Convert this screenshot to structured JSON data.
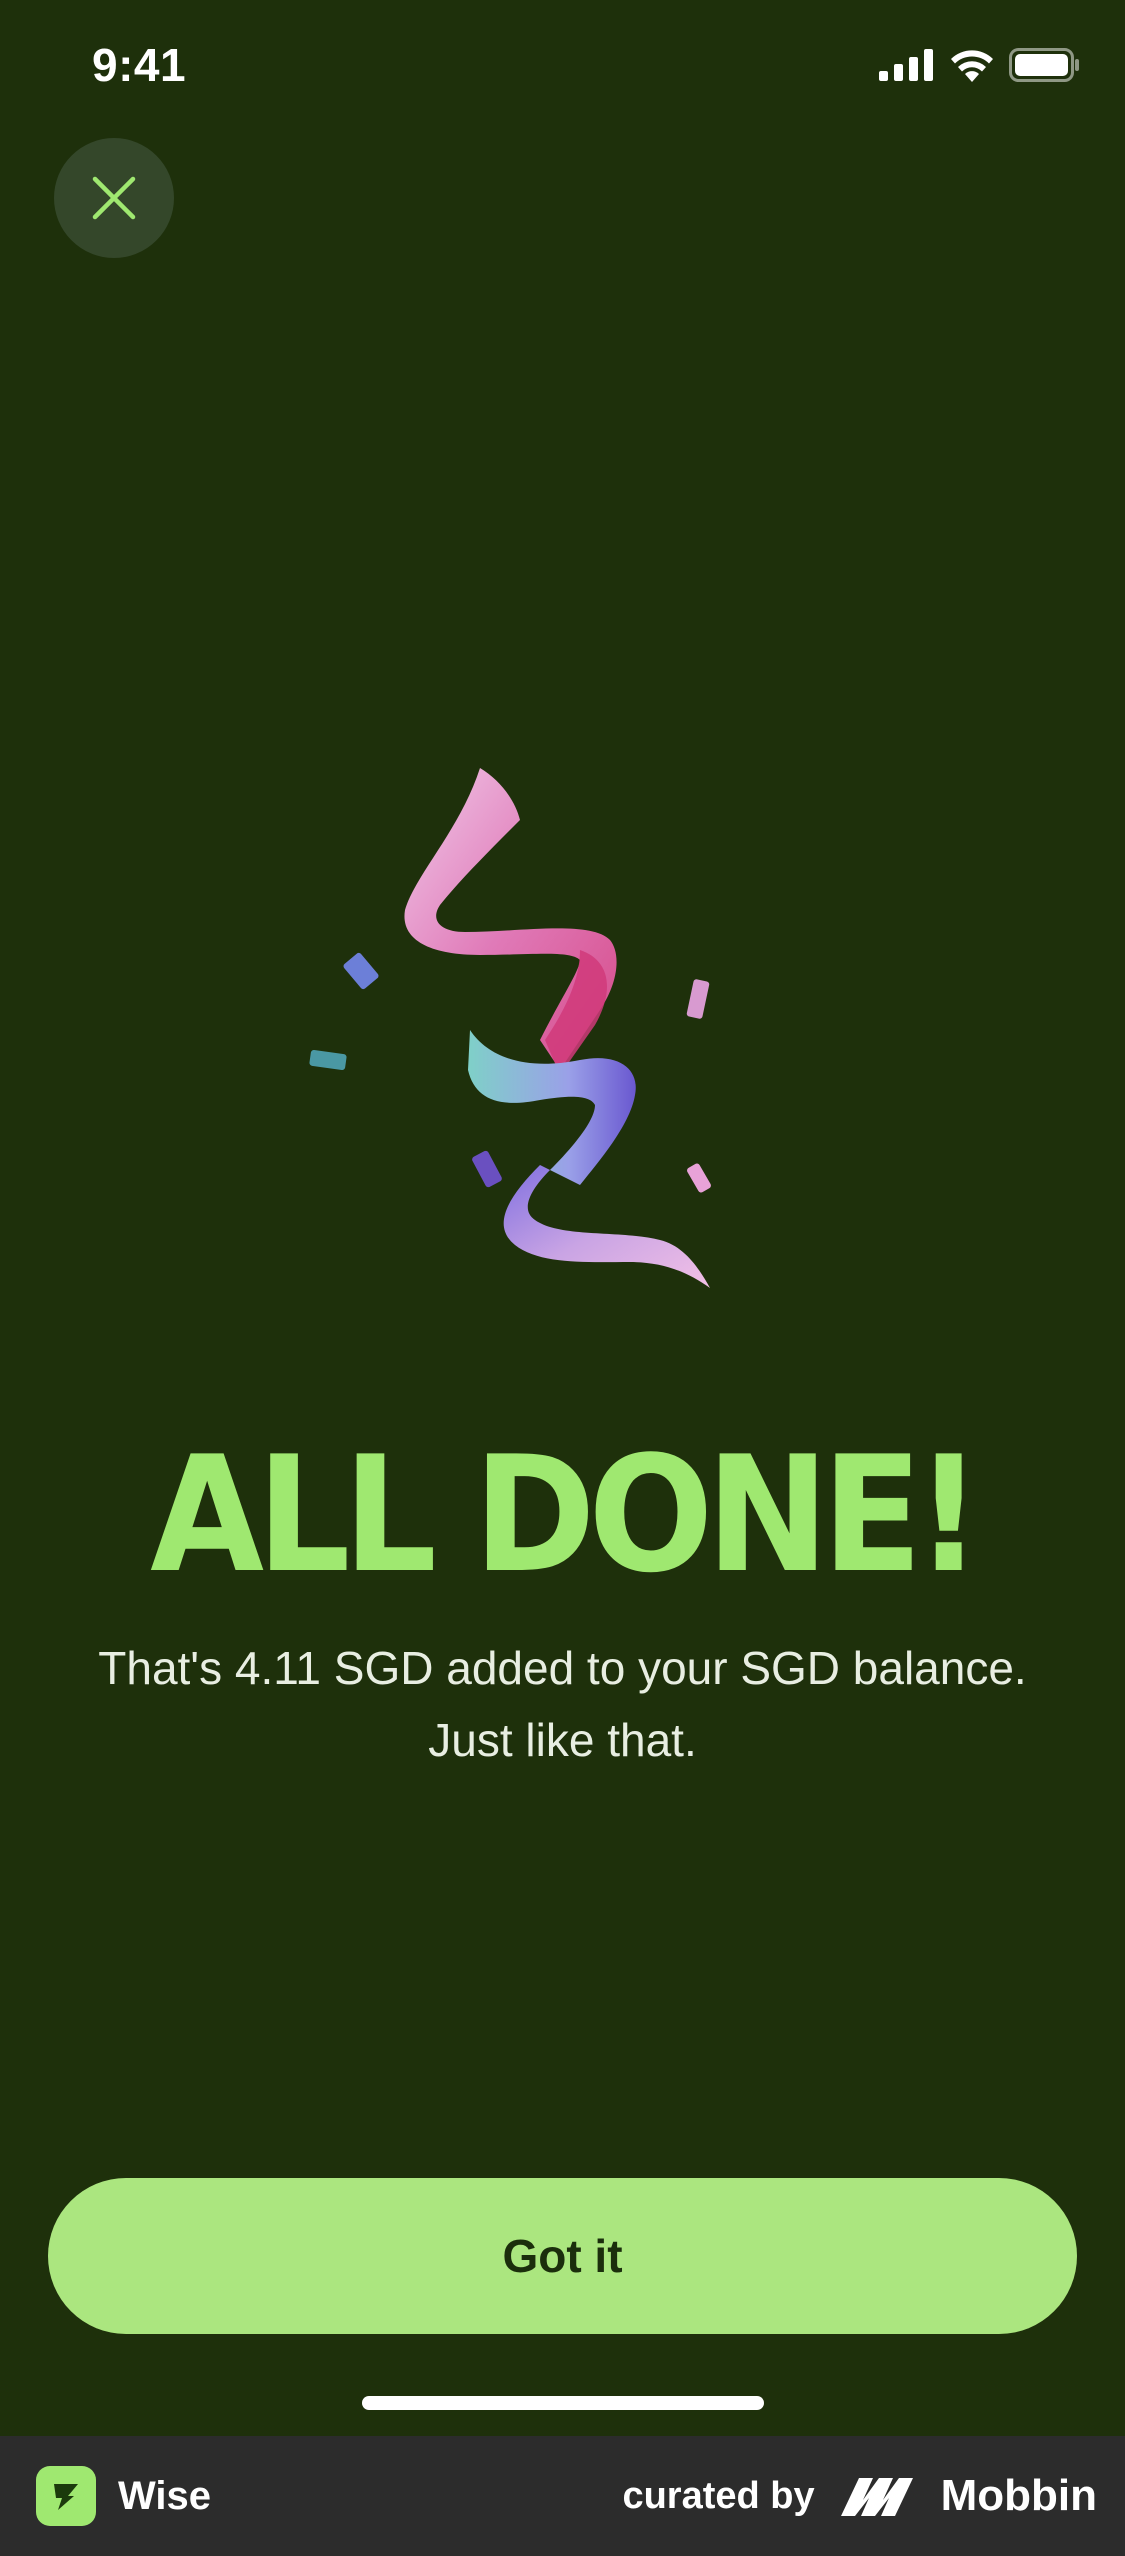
{
  "status_bar": {
    "time": "9:41",
    "icons": [
      "cellular-signal-icon",
      "wifi-icon",
      "battery-icon"
    ]
  },
  "close_button": {
    "icon": "close-icon"
  },
  "illustration": {
    "icon": "confetti-ribbon-icon"
  },
  "main": {
    "title": "ALL DONE!",
    "message_line1": "That's 4.11 SGD added to your SGD balance.",
    "message_line2": "Just like that."
  },
  "actions": {
    "primary_label": "Got it"
  },
  "footer": {
    "app_name": "Wise",
    "app_logo_icon": "wise-logo-icon",
    "credit_text": "curated by",
    "brand_name": "Mobbin",
    "brand_logo_icon": "mobbin-logo-icon"
  },
  "colors": {
    "background": "#1e300b",
    "accent": "#9fe870",
    "button": "#abe67f",
    "button_text": "#1b2e0c",
    "close_bg": "#34472a",
    "footer_bg": "#2c2c2c"
  }
}
